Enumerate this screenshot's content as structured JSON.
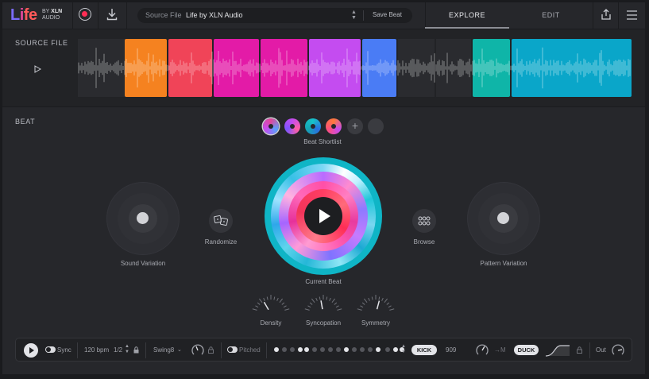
{
  "header": {
    "logo": {
      "l1": "L",
      "l2": "i",
      "l3": "fe"
    },
    "brand_by": "BY",
    "brand_xln": "XLN",
    "brand_audio": "AUDIO",
    "source_label": "Source File",
    "source_value": "Life by XLN Audio",
    "save_beat": "Save Beat",
    "tabs": [
      {
        "label": "EXPLORE",
        "active": true
      },
      {
        "label": "EDIT",
        "active": false
      }
    ]
  },
  "source_file": {
    "title": "SOURCE FILE",
    "segment_colors": [
      "#f58220",
      "#f04458",
      "#e31ba7",
      "#e31ba7",
      "#c44cf0",
      "#4a7cf5",
      "#0fb5a8",
      "#0aa6c9"
    ]
  },
  "beat": {
    "title": "BEAT",
    "shortlist_label": "Beat Shortlist",
    "sound_variation_label": "Sound Variation",
    "randomize_label": "Randomize",
    "current_beat_label": "Current Beat",
    "browse_label": "Browse",
    "pattern_variation_label": "Pattern Variation",
    "dials": [
      {
        "label": "Density"
      },
      {
        "label": "Syncopation"
      },
      {
        "label": "Symmetry"
      }
    ]
  },
  "transport": {
    "sync_label": "Sync",
    "bpm": "120 bpm",
    "division": "1/2",
    "swing": "Swing8",
    "pitched_label": "Pitched",
    "kick_label": "KICK",
    "kit_value": "909",
    "m_label": "→M",
    "duck_label": "DUCK",
    "out_label": "Out"
  },
  "colors": {
    "accent_red": "#ff2d55",
    "background": "#26272b"
  },
  "icons": [
    "record-icon",
    "download-icon",
    "share-icon",
    "menu-icon",
    "play-icon",
    "dice-icon",
    "grid-icon",
    "lock-icon",
    "plus-icon"
  ]
}
